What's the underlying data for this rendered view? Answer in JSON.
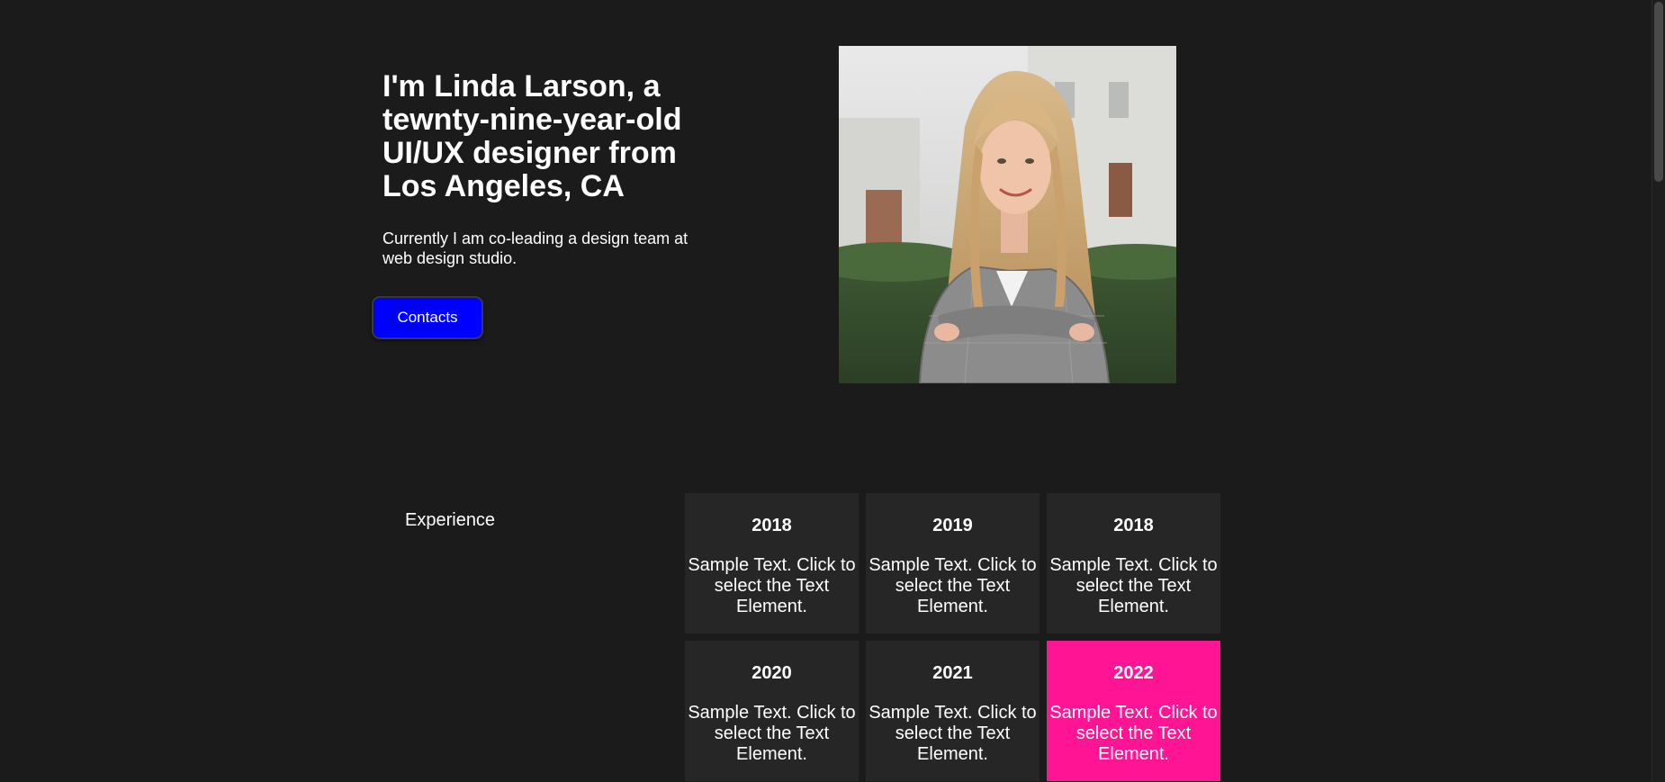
{
  "hero": {
    "title": "I'm Linda Larson, a tewnty-nine-year-old UI/UX designer from Los Angeles, CA",
    "subtitle": "Currently I am co-leading a design team at web design studio.",
    "contacts_label": "Contacts"
  },
  "experience": {
    "label": "Experience",
    "cards": [
      {
        "year": "2018",
        "text": "Sample Text. Click to select the Text Element."
      },
      {
        "year": "2019",
        "text": "Sample Text. Click to select the Text Element."
      },
      {
        "year": "2018",
        "text": "Sample Text. Click to select the Text Element."
      },
      {
        "year": "2020",
        "text": "Sample Text. Click to select the Text Element."
      },
      {
        "year": "2021",
        "text": "Sample Text. Click to select the Text Element."
      },
      {
        "year": "2022",
        "text": "Sample Text. Click to select the Text Element."
      }
    ]
  },
  "colors": {
    "background": "#1b1b1b",
    "card": "#262626",
    "highlight_card": "#ff1493",
    "button": "#0000ff"
  }
}
